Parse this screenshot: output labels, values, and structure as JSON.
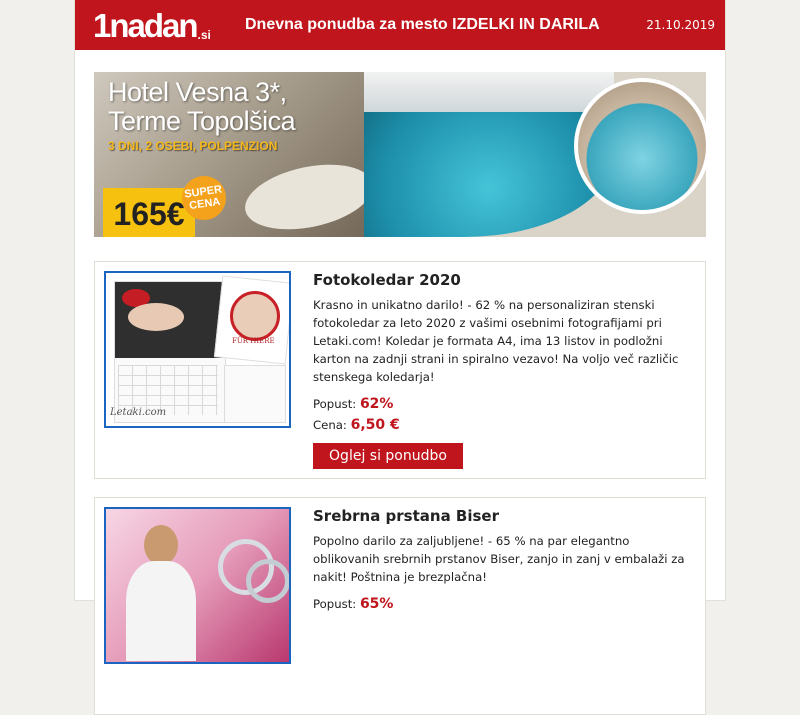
{
  "header": {
    "logo_main": "1nadan",
    "logo_tld": ".si",
    "title_prefix": "Dnevna ponudba za mesto",
    "title_city": "IZDELKI IN DARILA",
    "date": "21.10.2019",
    "brand_color": "#c0151c"
  },
  "banner": {
    "hotel_title_line1": "Hotel Vesna 3*,",
    "hotel_title_line2": "Terme Topolšica",
    "subtitle": "3 DNI, 2 OSEBI, POLPENZION",
    "price": "165€",
    "badge_line1": "SUPER",
    "badge_line2": "CENA"
  },
  "offers": [
    {
      "title": "Fotokoledar 2020",
      "description": "Krasno in unikatno darilo! - 62 % na personaliziran stenski fotokoledar za leto 2020 z vašimi osebnimi fotografijami pri Letaki.com! Koledar je formata A4, ima 13 listov in podložni karton na zadnji strani in spiralno vezavo! Na voljo več različic stenskega koledarja!",
      "discount_label": "Popust:",
      "discount_value": "62%",
      "price_label": "Cena:",
      "price_value": "6,50 €",
      "cta_label": "Oglej si ponudbo",
      "thumb_caption": "Letaki.com",
      "thumb_text": "FÜR HIERE"
    },
    {
      "title": "Srebrna prstana Biser",
      "description": "Popolno darilo za zaljubljene! - 65 % na par elegantno oblikovanih srebrnih prstanov Biser, zanjo in zanj v embalaži za nakit! Poštnina je brezplačna!",
      "discount_label": "Popust:",
      "discount_value": "65%"
    }
  ]
}
